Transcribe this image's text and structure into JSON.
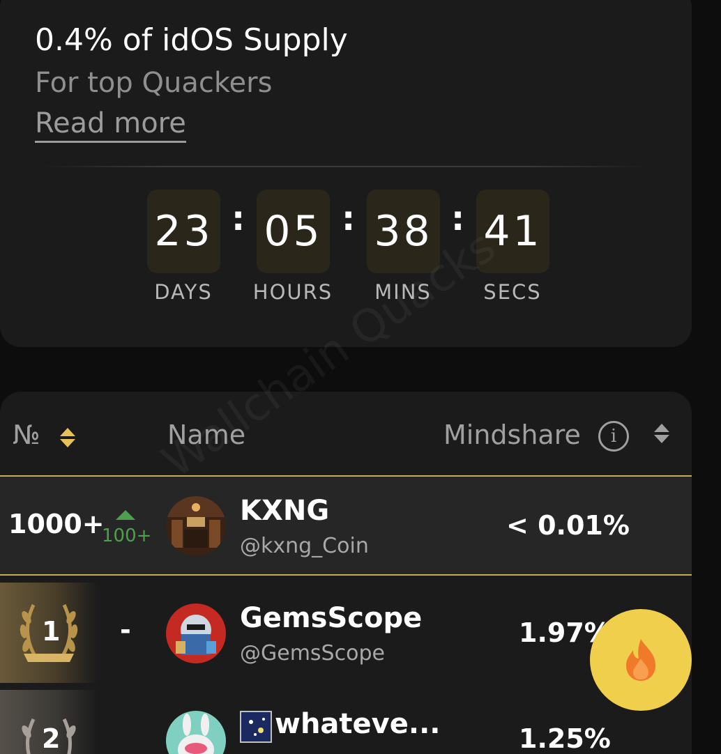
{
  "promo": {
    "title": "0.4% of idOS Supply",
    "subtitle": "For top Quackers",
    "read_more": "Read more"
  },
  "countdown": {
    "days": "23",
    "hours": "05",
    "mins": "38",
    "secs": "41",
    "separator": ":",
    "labels": {
      "days": "DAYS",
      "hours": "HOURS",
      "mins": "MINS",
      "secs": "SECS"
    }
  },
  "leaderboard": {
    "headers": {
      "rank": "№",
      "name": "Name",
      "mindshare": "Mindshare"
    },
    "info_glyph": "i",
    "rows": [
      {
        "rank": "1000+",
        "change": "100+",
        "change_dir": "up",
        "name": "KXNG",
        "handle": "@kxng_Coin",
        "mindshare": "< 0.01%",
        "highlighted": true
      },
      {
        "rank": "1",
        "change": "-",
        "name": "GemsScope",
        "handle": "@GemsScope",
        "mindshare": "1.97%"
      },
      {
        "rank": "2",
        "name": "whateve...",
        "mindshare": "1.25%"
      }
    ]
  },
  "watermark": "Wallchain Quacks",
  "colors": {
    "accent_gold": "#c9ad58",
    "up_green": "#4da04d",
    "fab_yellow": "#f0cf4c",
    "flame_orange": "#f07a2a"
  }
}
